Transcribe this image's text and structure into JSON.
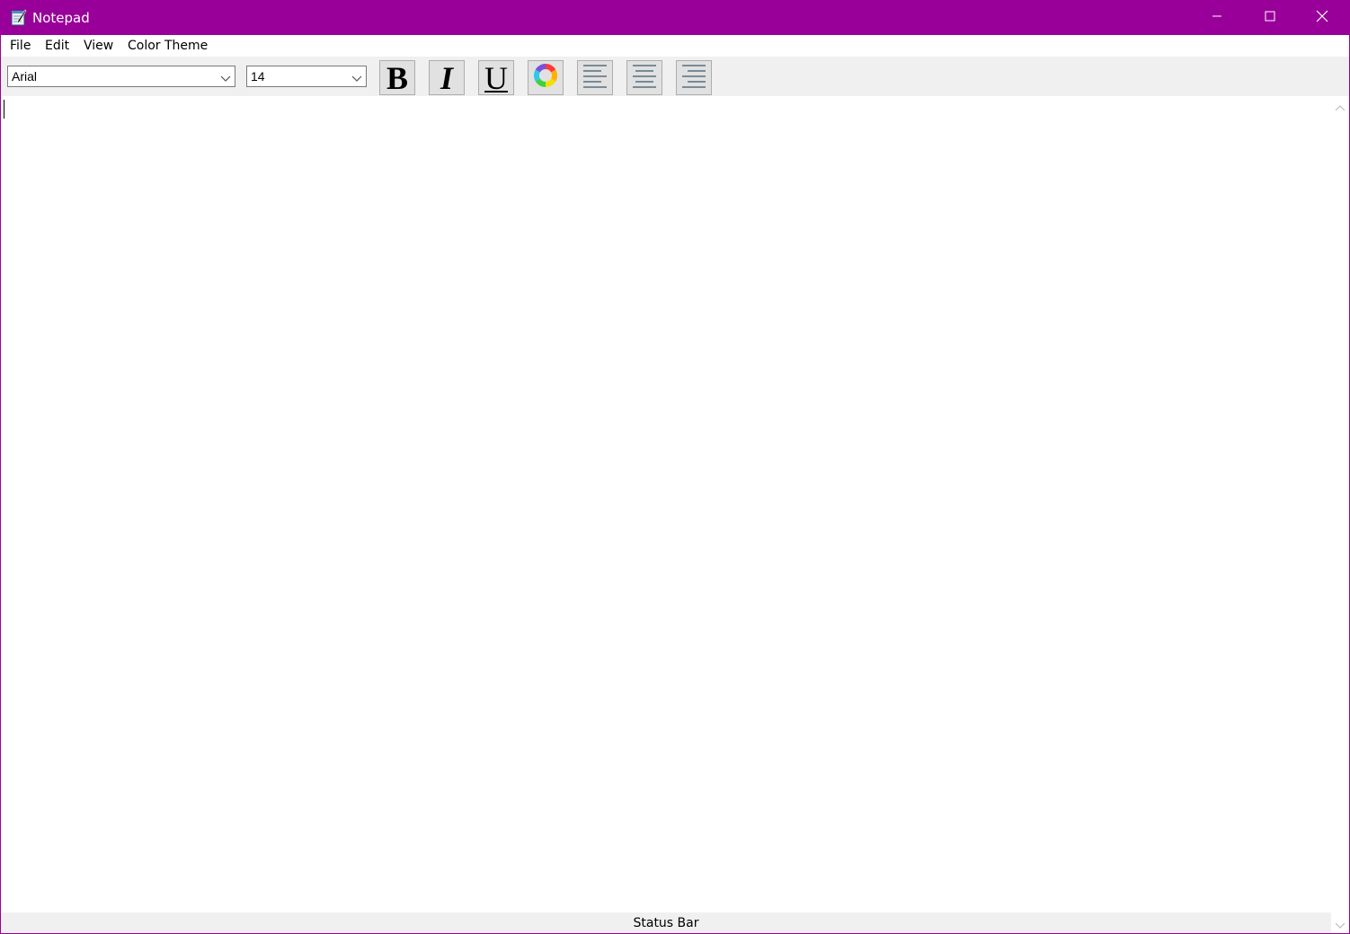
{
  "window": {
    "title": "Notepad",
    "accent_color": "#990099",
    "controls": {
      "minimize_icon": "minimize-icon",
      "maximize_icon": "maximize-icon",
      "close_icon": "close-icon"
    }
  },
  "menubar": {
    "items": [
      {
        "label": "File"
      },
      {
        "label": "Edit"
      },
      {
        "label": "View"
      },
      {
        "label": "Color Theme"
      }
    ]
  },
  "toolbar": {
    "font_family": "Arial",
    "font_size": "14",
    "bold_glyph": "B",
    "italic_glyph": "I",
    "underline_glyph": "U",
    "buttons": [
      {
        "icon": "bold-icon"
      },
      {
        "icon": "italic-icon"
      },
      {
        "icon": "underline-icon"
      },
      {
        "icon": "color-wheel-icon"
      },
      {
        "icon": "align-left-icon"
      },
      {
        "icon": "align-center-icon"
      },
      {
        "icon": "align-right-icon"
      }
    ]
  },
  "editor": {
    "content": ""
  },
  "statusbar": {
    "text": "Status Bar"
  }
}
